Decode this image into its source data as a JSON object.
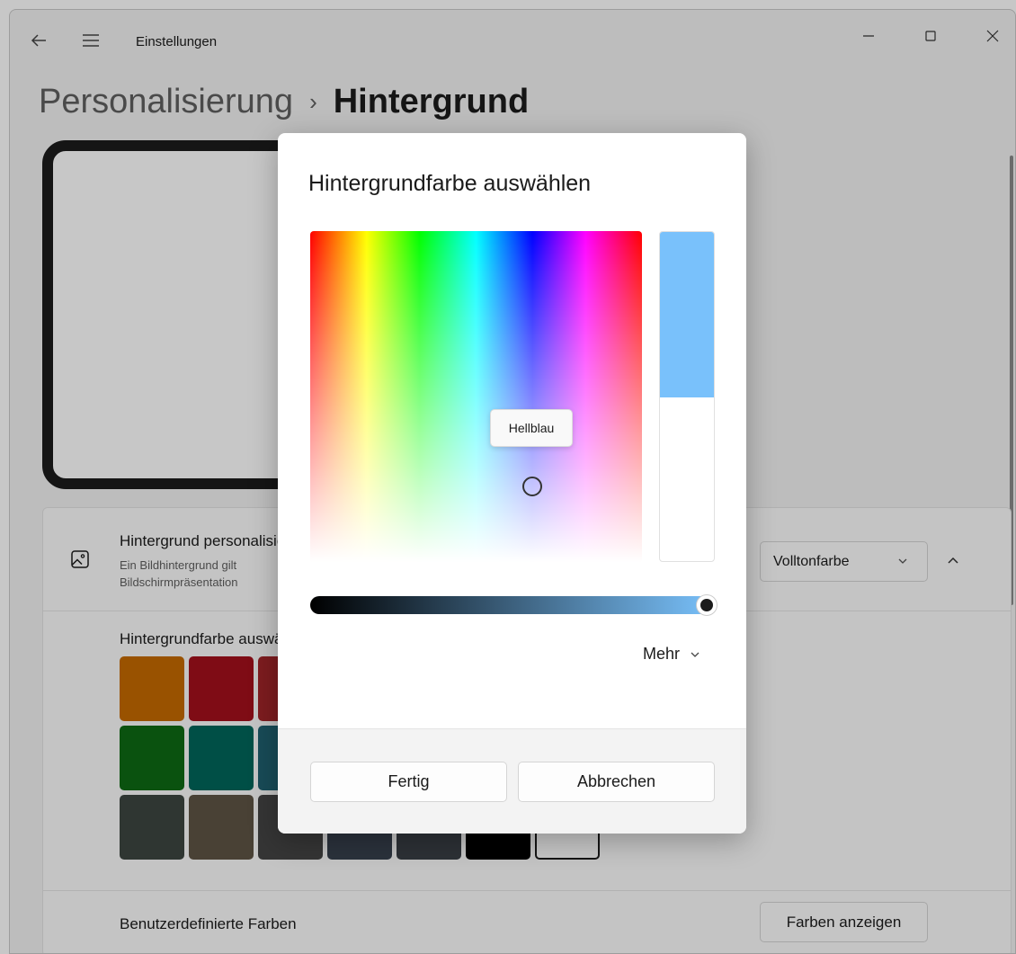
{
  "app": {
    "title": "Einstellungen"
  },
  "breadcrumb": {
    "parent": "Personalisierung",
    "separator": "›",
    "current": "Hintergrund"
  },
  "settings_card": {
    "background_row": {
      "title": "Hintergrund personalisieren",
      "description_line1": "Ein Bildhintergrund gilt",
      "description_line2": "Bildschirmpräsentation",
      "dropdown_value": "Volltonfarbe"
    },
    "colors_title": "Hintergrundfarbe auswählen",
    "swatches": [
      "#c46a00",
      "#a3101c",
      "#a02528",
      "#8a1f3e",
      "#7d2050",
      "#5e2a6e",
      "#3a3a8c",
      "#0e6a14",
      "#00665a",
      "#1f6170",
      "#1a5a6e",
      "#185a88",
      "#3a4680",
      "#4a4a7a",
      "#3d4640",
      "#5e5444",
      "#444444",
      "#38404d",
      "#3a3f46",
      "#000000",
      "#ffffff"
    ],
    "custom_colors_label": "Benutzerdefinierte Farben",
    "show_colors_button": "Farben anzeigen"
  },
  "dialog": {
    "title": "Hintergrundfarbe auswählen",
    "tooltip": "Hellblau",
    "selected_color": "#79c1fb",
    "brightness_percent": 100,
    "more_label": "Mehr",
    "done_button": "Fertig",
    "cancel_button": "Abbrechen"
  }
}
